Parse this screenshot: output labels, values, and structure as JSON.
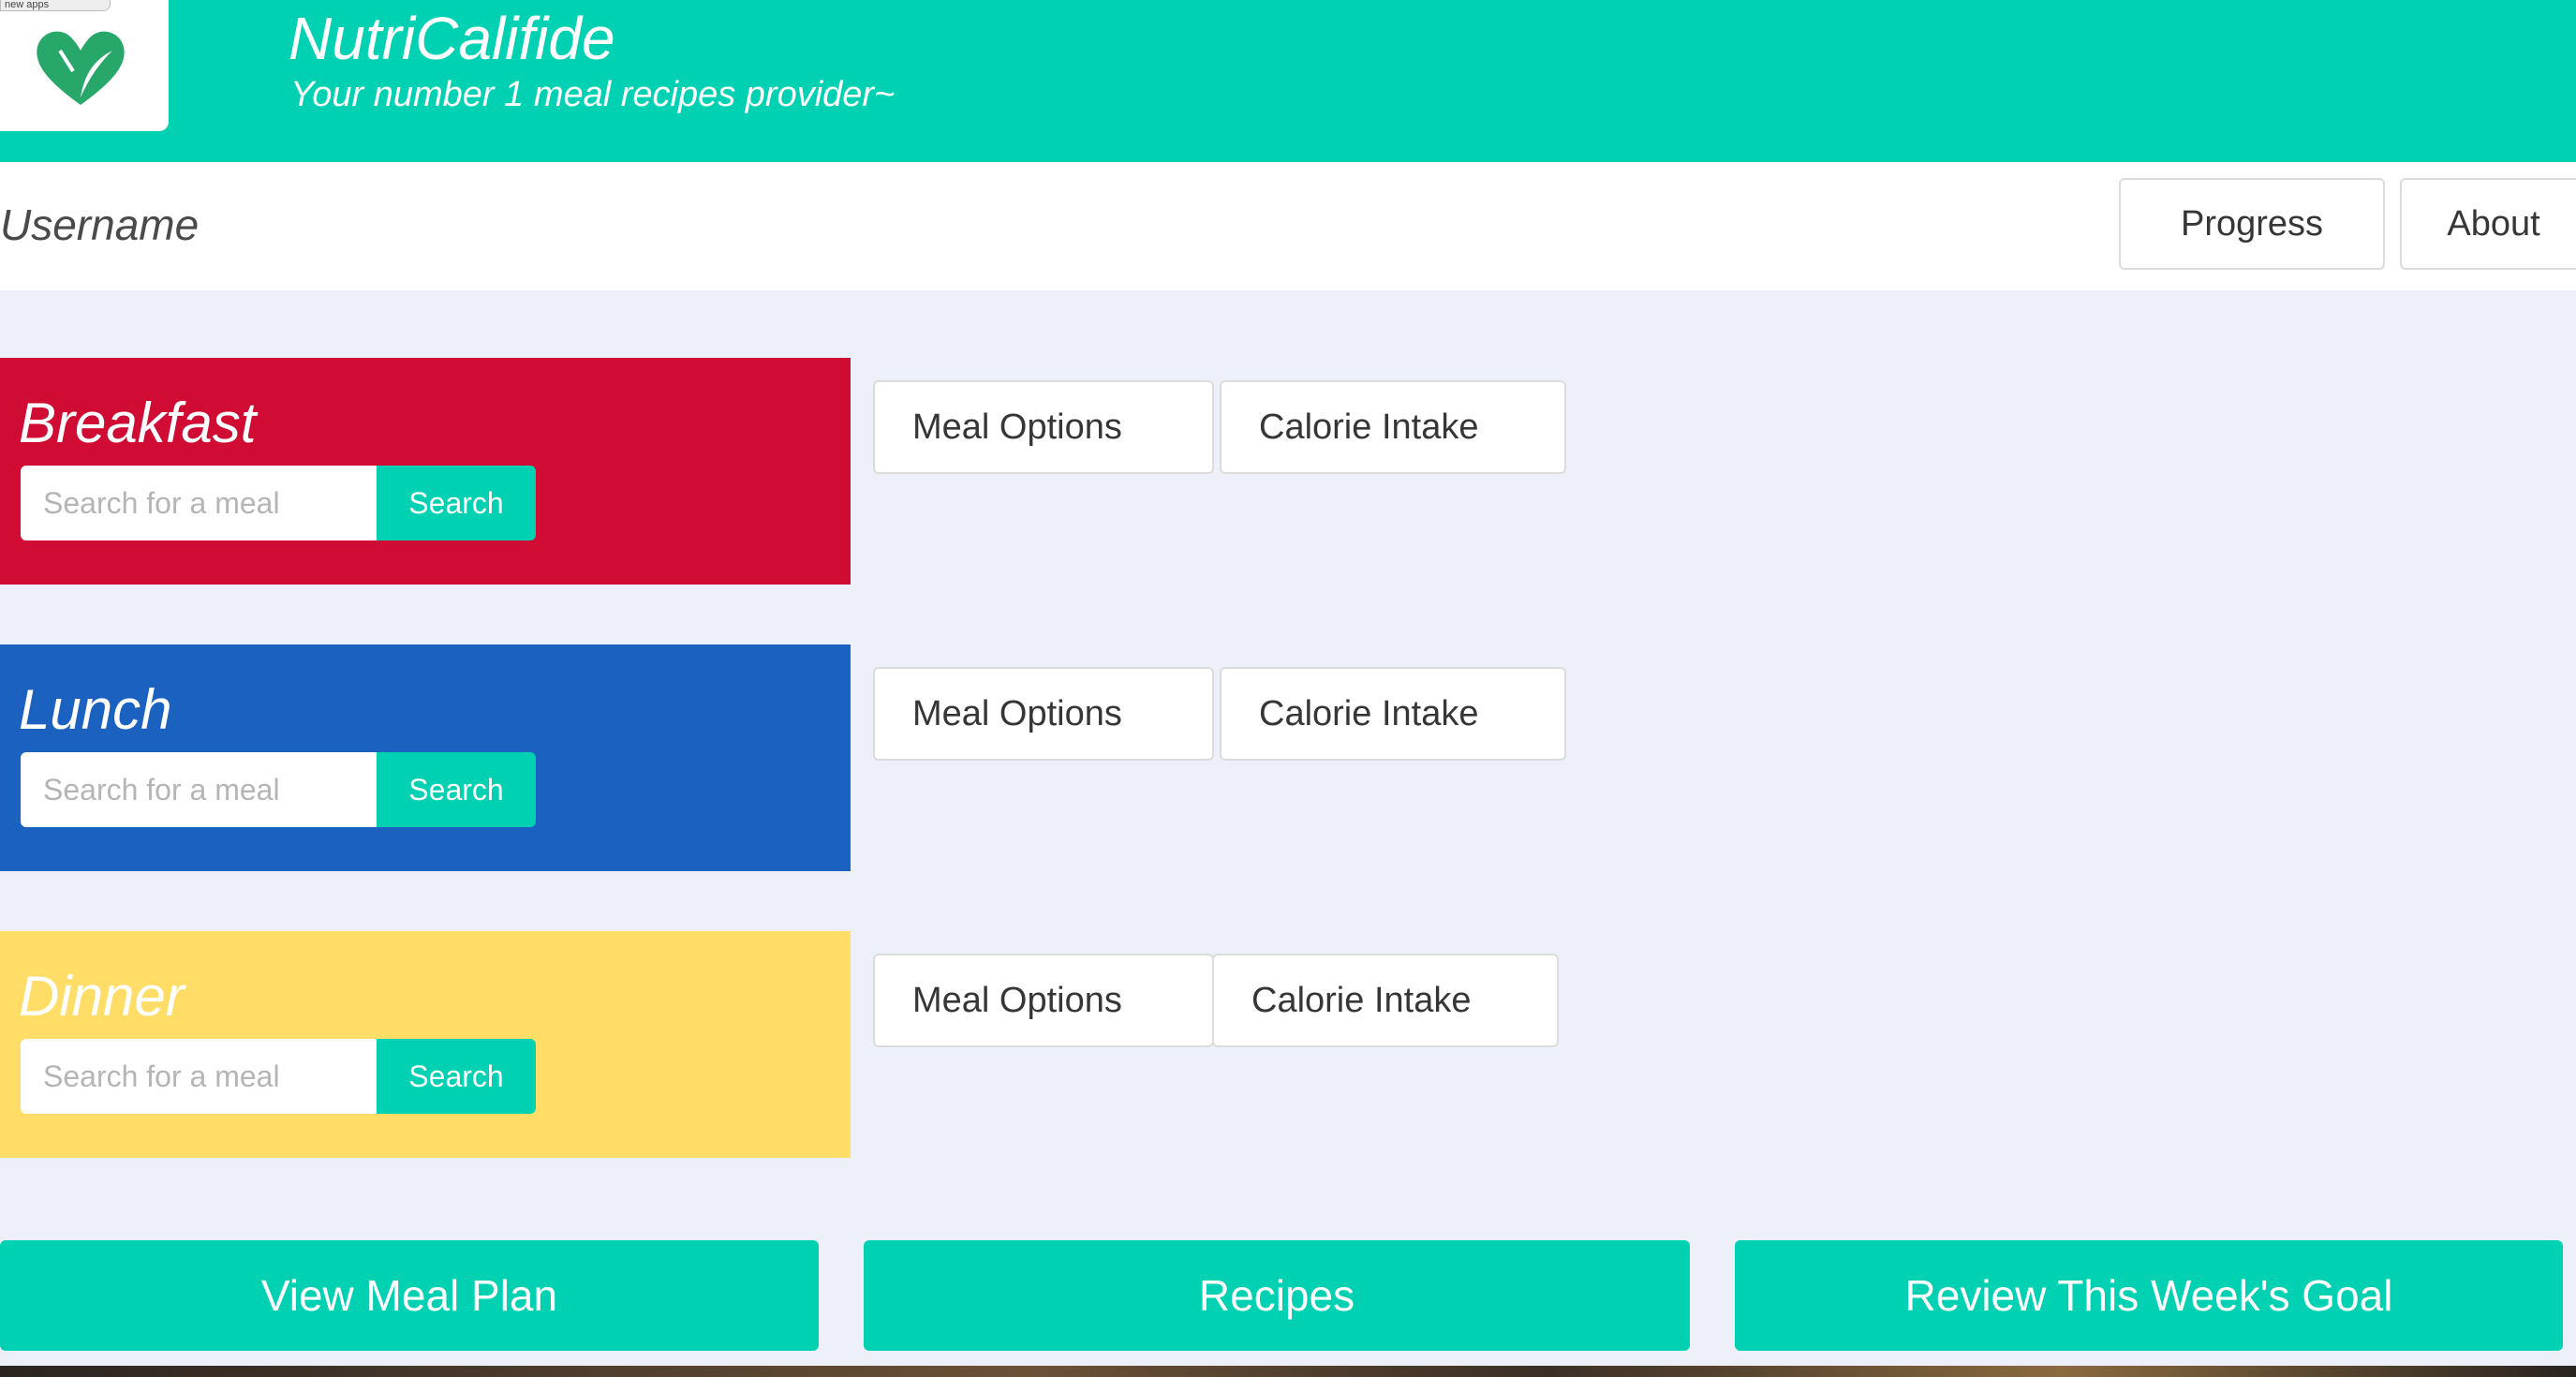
{
  "header": {
    "title": "NutriCalifide",
    "subtitle": "Your number 1 meal recipes provider~",
    "logo_icon": "heart-leaf-fork-icon",
    "tooltip_text": "new apps",
    "brand_color": "#00d1b2"
  },
  "navbar": {
    "username": "Username",
    "progress_label": "Progress",
    "about_label": "About"
  },
  "meals": [
    {
      "title": "Breakfast",
      "color": "#d00c34",
      "search_placeholder": "Search for a meal",
      "search_label": "Search",
      "options_label": "Meal Options",
      "calorie_label": "Calorie Intake"
    },
    {
      "title": "Lunch",
      "color": "#1b62c0",
      "search_placeholder": "Search for a meal",
      "search_label": "Search",
      "options_label": "Meal Options",
      "calorie_label": "Calorie Intake"
    },
    {
      "title": "Dinner",
      "color": "#ffdd66",
      "search_placeholder": "Search for a meal",
      "search_label": "Search",
      "options_label": "Meal Options",
      "calorie_label": "Calorie Intake"
    }
  ],
  "footer_buttons": {
    "view_meal_plan": "View Meal Plan",
    "recipes": "Recipes",
    "review_goal": "Review This Week's Goal"
  }
}
